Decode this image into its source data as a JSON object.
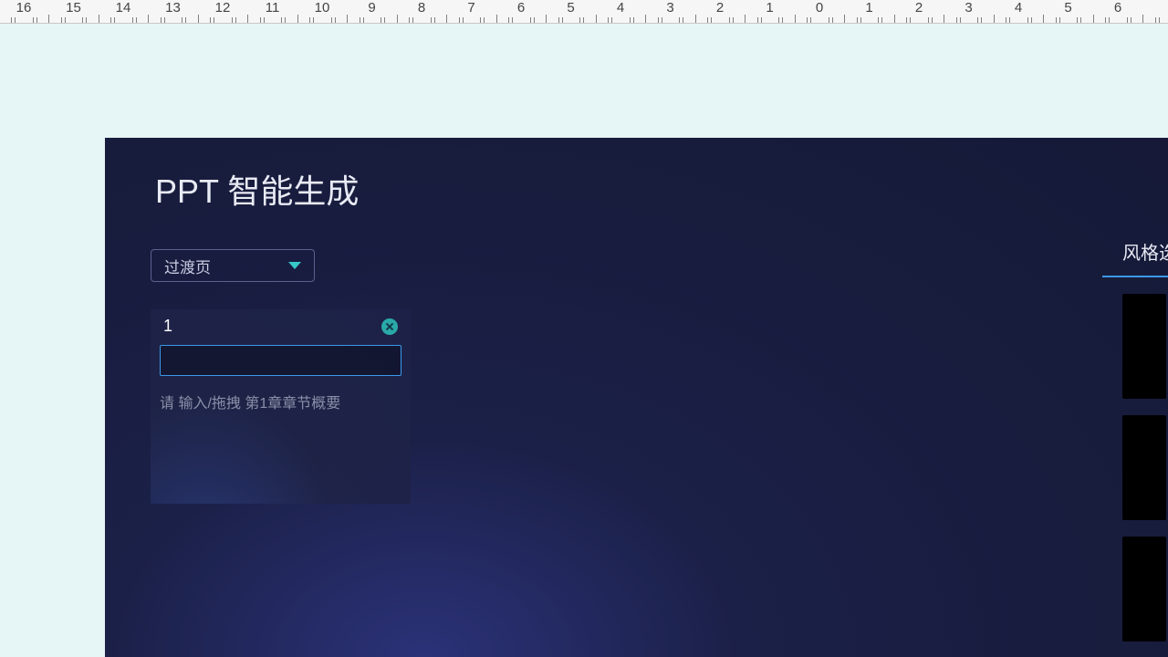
{
  "ruler": {
    "labels_left": [
      16,
      15,
      14,
      13,
      12,
      11,
      10,
      9,
      8,
      7,
      6,
      5,
      4,
      3,
      2,
      1,
      0
    ],
    "labels_right": [
      1,
      2,
      3,
      4,
      5,
      6
    ]
  },
  "panel": {
    "title": "PPT 智能生成",
    "dropdown": {
      "selected": "过渡页"
    },
    "chapter": {
      "number": "1",
      "title_input_value": "",
      "summary_placeholder": "请 输入/拖拽 第1章章节概要"
    }
  },
  "right": {
    "title": "风格选"
  }
}
